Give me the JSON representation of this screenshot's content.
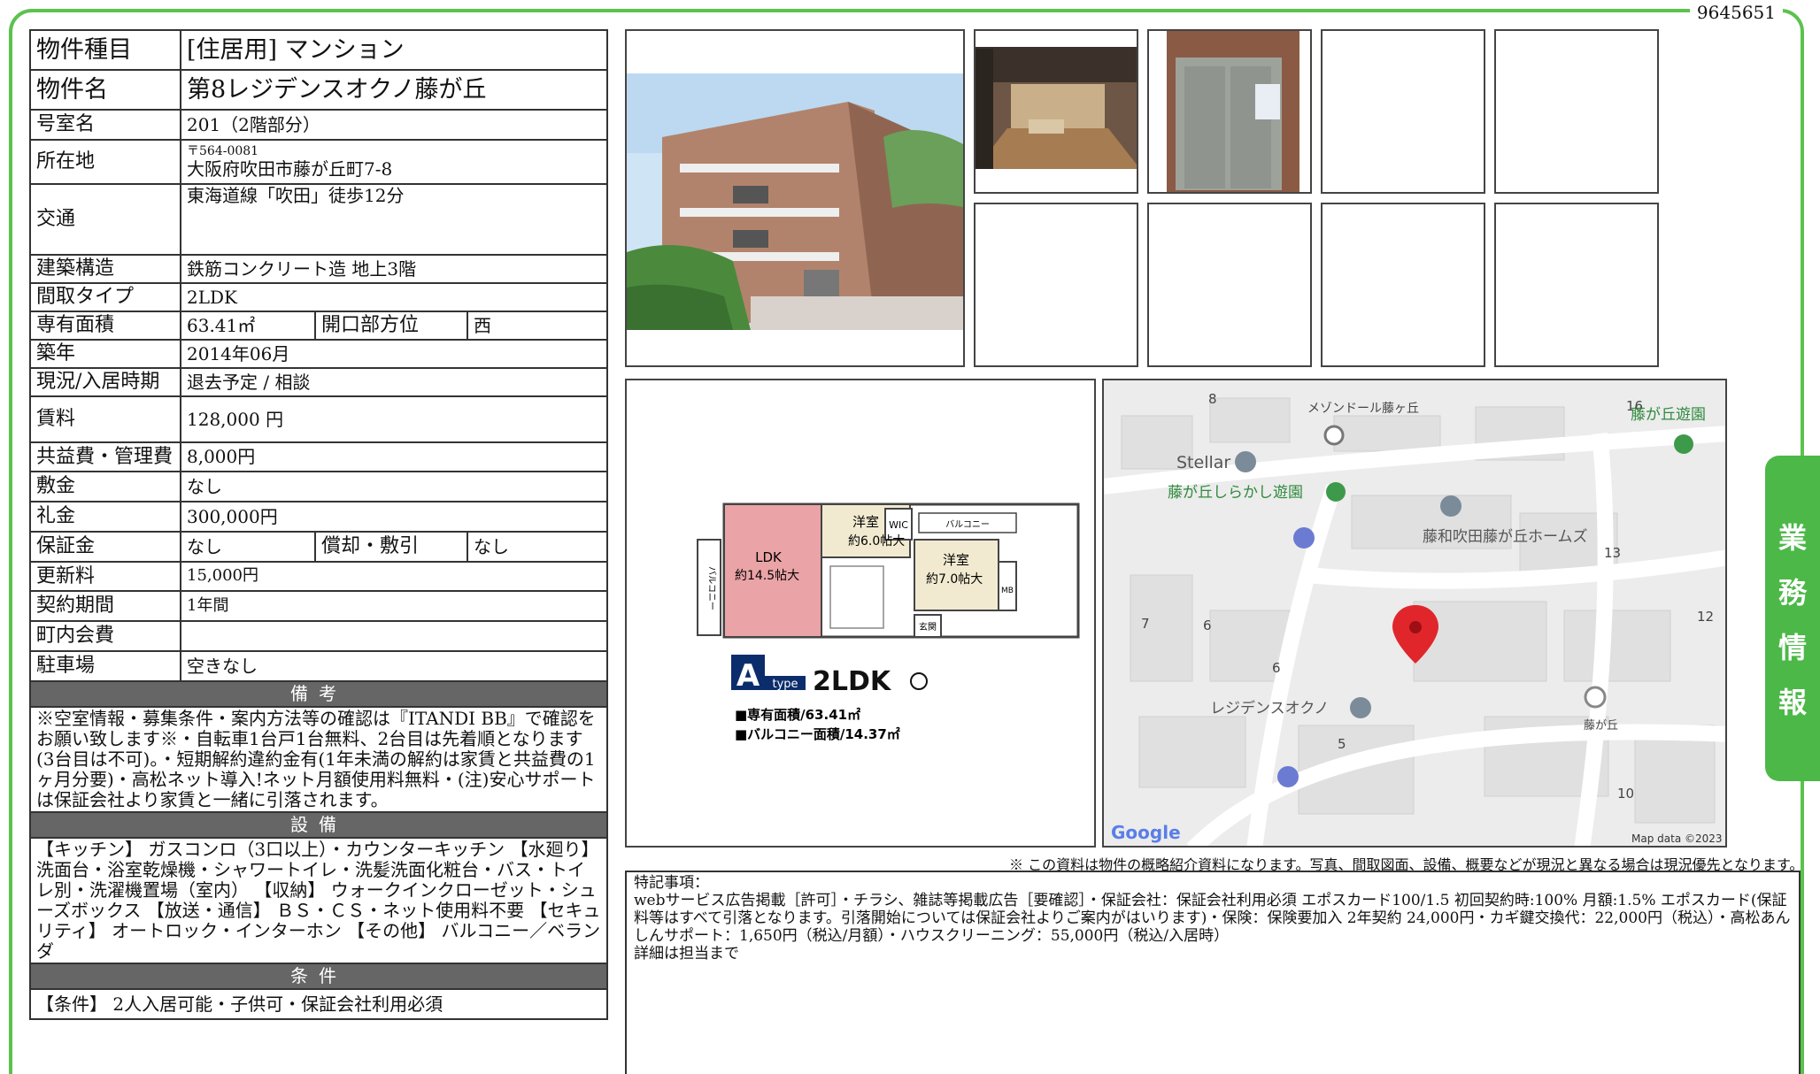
{
  "doc_id": "9645651",
  "side_tab": [
    "業",
    "務",
    "情",
    "報"
  ],
  "property": {
    "type_label": "物件種目",
    "type_value": "[住居用] マンション",
    "name_label": "物件名",
    "name_value": "第8レジデンスオクノ藤が丘",
    "room_label": "号室名",
    "room_value": "201（2階部分）",
    "address_label": "所在地",
    "postal": "〒564-0081",
    "address_value": "大阪府吹田市藤が丘町7-8",
    "access_label": "交通",
    "access_value": "東海道線「吹田」徒歩12分",
    "structure_label": "建築構造",
    "structure_value": "鉄筋コンクリート造 地上3階",
    "layout_label": "間取タイプ",
    "layout_value": "2LDK",
    "area_label": "専有面積",
    "area_value": "63.41㎡",
    "direction_label": "開口部方位",
    "direction_value": "西",
    "built_label": "築年",
    "built_value": "2014年06月",
    "status_label": "現況/入居時期",
    "status_value": "退去予定 / 相談",
    "rent_label": "賃料",
    "rent_value": "128,000 円",
    "fee_label": "共益費・管理費",
    "fee_value": "8,000円",
    "deposit_label": "敷金",
    "deposit_value": "なし",
    "key_money_label": "礼金",
    "key_money_value": "300,000円",
    "guarantee_label": "保証金",
    "guarantee_value": "なし",
    "amort_label": "償却・敷引",
    "amort_value": "なし",
    "renewal_label": "更新料",
    "renewal_value": "15,000円",
    "contract_label": "契約期間",
    "contract_value": "1年間",
    "assoc_label": "町内会費",
    "assoc_value": "",
    "parking_label": "駐車場",
    "parking_value": "空きなし"
  },
  "sections": {
    "notes_title": "備考",
    "notes_text": "※空室情報・募集条件・案内方法等の確認は『ITANDI BB』で確認をお願い致します※・自転車1台戸1台無料、2台目は先着順となります(3台目は不可)。・短期解約違約金有(1年未満の解約は家賃と共益費の1ヶ月分要)・高松ネット導入!ネット月額使用料無料・(注)安心サポートは保証会社より家賃と一緒に引落されます。",
    "equipment_title": "設備",
    "equipment_text": "【キッチン】 ガスコンロ（3口以上）・カウンターキッチン 【水廻り】 洗面台・浴室乾燥機・シャワートイレ・洗髪洗面化粧台・バス・トイレ別・洗濯機置場（室内） 【収納】 ウォークインクローゼット・シューズボックス 【放送・通信】 ＢＳ・ＣＳ・ネット使用料不要 【セキュリティ】 オートロック・インターホン 【その他】 バルコニー／ベランダ",
    "conditions_title": "条件",
    "conditions_text": "【条件】 2人入居可能・子供可・保証会社利用必須"
  },
  "floorplan": {
    "room1": "洋室",
    "room1_size": "約6.0帖大",
    "room2": "洋室",
    "room2_size": "約7.0帖大",
    "ldk": "LDK",
    "ldk_size": "約14.5帖大",
    "wic": "WIC",
    "balcony_top": "バルコニー",
    "balcony_side": "バルコニー",
    "entrance": "玄関",
    "mb": "MB",
    "type_letter": "A",
    "type_word": "type",
    "type_layout": "2LDK",
    "area_line": "■専有面積/63.41㎡",
    "balcony_line": "■バルコニー面積/14.37㎡"
  },
  "map": {
    "labels": [
      "メゾンドール藤ヶ丘",
      "Stellar",
      "藤が丘しらかし遊園",
      "藤和吹田藤が丘ホームズ",
      "レジデンスオクノ",
      "藤が丘",
      "藤が丘遊園"
    ],
    "numbers": [
      "8",
      "16",
      "13",
      "12",
      "7",
      "6",
      "6",
      "5",
      "10"
    ],
    "google": "Google",
    "credit": "Map data ©2023"
  },
  "notice": "※ この資料は物件の概略紹介資料になります。写真、間取図面、設備、概要などが現況と異なる場合は現況優先となります。",
  "remarks": {
    "title": "特記事項：",
    "line1": "webサービス広告掲載［許可］・チラシ、雑誌等掲載広告［要確認］・保証会社：保証会社利用必須 エポスカード100/1.5 初回契約時:100% 月額:1.5% エポスカード(保証料等はすべて引落となります。引落開始については保証会社よりご案内がはいります)・保険：保険要加入 2年契約 24,000円・カギ鍵交換代：22,000円（税込）・高松あんしんサポート：1,650円（税込/月額）・ハウスクリーニング：55,000円（税込/入居時）",
    "line2": "詳細は担当まで"
  },
  "colors": {
    "frame": "#5cc24e",
    "tab": "#4cb848",
    "section": "#666666",
    "pin": "#e0262b"
  }
}
